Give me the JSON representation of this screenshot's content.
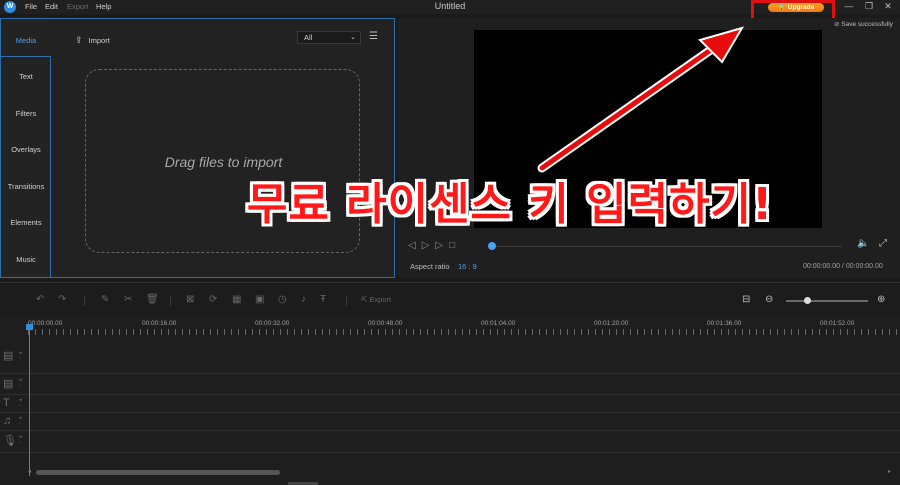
{
  "app": {
    "logo_text": "W",
    "title": "Untitled",
    "menu": [
      "File",
      "Edit",
      "Export",
      "Help"
    ],
    "upgrade_label": "Upgrade",
    "upgrade_icon": "lock-icon",
    "window_controls": {
      "minimize": "—",
      "restore": "❐",
      "close": "✕"
    }
  },
  "left_panel": {
    "tabs": [
      "Media",
      "Text",
      "Filters",
      "Overlays",
      "Transitions",
      "Elements",
      "Music"
    ],
    "active_tab": "Media",
    "import_label": "Import",
    "import_icon": "import-icon",
    "filter_value": "All",
    "drop_text": "Drag files to import"
  },
  "preview": {
    "save_status": "Save successfully",
    "aspect_label": "Aspect ratio",
    "aspect_value": "16 : 9",
    "timecode": "00:00:00.00 / 00:00:00.00",
    "seek_progress": 0
  },
  "overlay": {
    "caption": "무료 라이센스 키 입력하기!",
    "color": "#ff1a1a"
  },
  "toolbar": {
    "export_label": "Export",
    "zoom_level": 0.22
  },
  "timeline": {
    "ruler_labels": [
      "00:00:00.00",
      "00:00:16.00",
      "00:00:32.00",
      "00:00:48.00",
      "00:01:04.00",
      "00:01:20.00",
      "00:01:36.00",
      "00:01:52.00"
    ],
    "tracks": [
      "video-track",
      "pip-track",
      "text-track",
      "music-track",
      "voice-track"
    ]
  },
  "colors": {
    "accent": "#2f8ee0",
    "upgrade": "#f58a1c",
    "background": "#1b1b1b"
  }
}
